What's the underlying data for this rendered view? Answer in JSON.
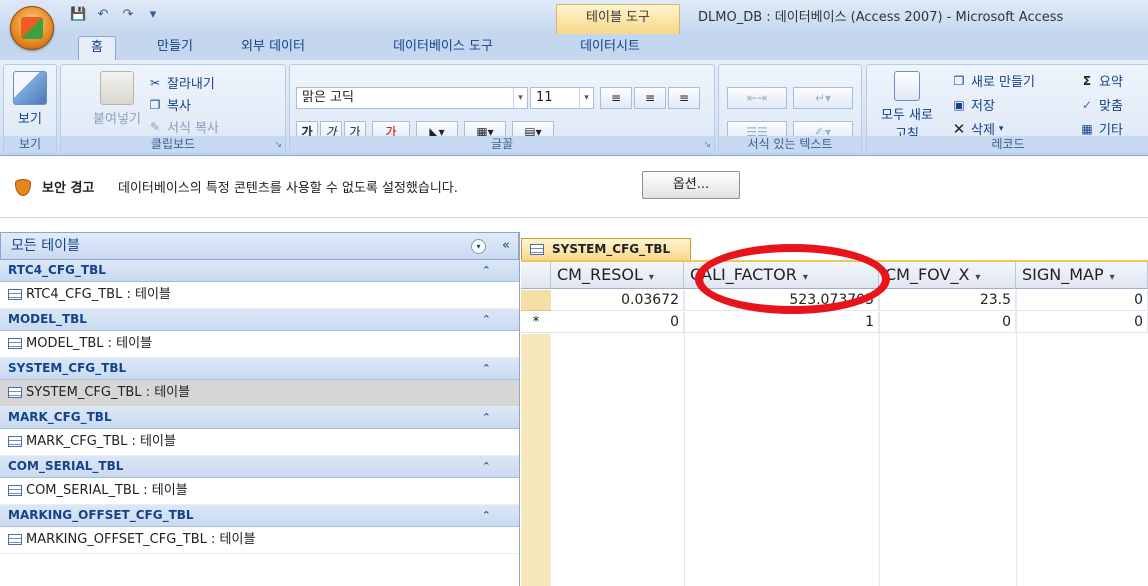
{
  "window": {
    "context_tab_title": "테이블 도구",
    "title": "DLMO_DB : 데이터베이스 (Access 2007) - Microsoft Access"
  },
  "tabs": [
    "홈",
    "만들기",
    "외부 데이터",
    "데이터베이스 도구",
    "데이터시트"
  ],
  "ribbon": {
    "view": {
      "label": "보기",
      "group": "보기"
    },
    "clipboard": {
      "paste": "붙여넣기",
      "cut": "잘라내기",
      "copy": "복사",
      "format_painter": "서식 복사",
      "group": "클립보드"
    },
    "font": {
      "family": "맑은 고딕",
      "size": "11",
      "group": "글꼴",
      "bold": "가",
      "italic": "가",
      "underline": "가",
      "color": "가"
    },
    "rich_text": {
      "group": "서식 있는 텍스트"
    },
    "records": {
      "refresh_all": "모두 새로",
      "refresh_all_2": "고침",
      "new": "새로 만들기",
      "save": "저장",
      "delete": "삭제",
      "totals": "요약",
      "spelling": "맞춤",
      "more": "기타",
      "group": "레코드"
    }
  },
  "security": {
    "title": "보안 경고",
    "message": "데이터베이스의 특정 콘텐츠를 사용할 수 없도록 설정했습니다.",
    "options_button": "옵션..."
  },
  "nav": {
    "header": "모든 테이블",
    "groups": [
      {
        "name": "RTC4_CFG_TBL",
        "item": "RTC4_CFG_TBL : 테이블"
      },
      {
        "name": "MODEL_TBL",
        "item": "MODEL_TBL : 테이블"
      },
      {
        "name": "SYSTEM_CFG_TBL",
        "item": "SYSTEM_CFG_TBL : 테이블"
      },
      {
        "name": "MARK_CFG_TBL",
        "item": "MARK_CFG_TBL : 테이블"
      },
      {
        "name": "COM_SERIAL_TBL",
        "item": "COM_SERIAL_TBL : 테이블"
      },
      {
        "name": "MARKING_OFFSET_CFG_TBL",
        "item": "MARKING_OFFSET_CFG_TBL : 테이블"
      }
    ]
  },
  "sheet": {
    "tab": "SYSTEM_CFG_TBL",
    "columns": [
      "CM_RESOL",
      "CALI_FACTOR",
      "CM_FOV_X",
      "SIGN_MAP"
    ],
    "rows": [
      {
        "marker": "",
        "values": [
          "0.03672",
          "523.073705",
          "23.5",
          "0"
        ]
      },
      {
        "marker": "*",
        "values": [
          "0",
          "1",
          "0",
          "0"
        ]
      }
    ]
  }
}
